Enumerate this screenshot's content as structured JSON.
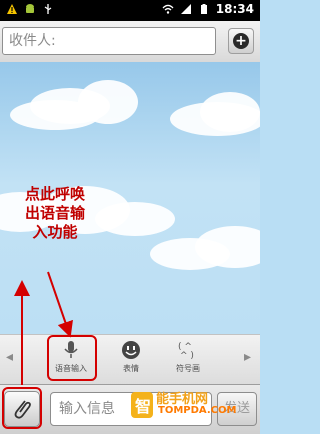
{
  "status_bar": {
    "time": "18:34",
    "icons": [
      "warning-icon",
      "android-icon",
      "usb-icon",
      "wifi-icon",
      "signal-icon",
      "battery-icon"
    ]
  },
  "recipient": {
    "placeholder": "收件人:",
    "add_icon": "plus-circle-icon"
  },
  "annotation": {
    "lines": [
      "点此呼唤",
      "出语音输",
      "入功能"
    ],
    "color": "#c00000"
  },
  "toolbar": {
    "items": [
      {
        "label": "语音输入",
        "icon": "microphone-icon"
      },
      {
        "label": "表情",
        "icon": "smiley-icon"
      },
      {
        "label": "符号画",
        "icon": "symbol-art-icon"
      }
    ]
  },
  "composer": {
    "placeholder": "输入信息",
    "send_label": "发送",
    "attach_icon": "paperclip-icon"
  },
  "watermark": {
    "brand": "能手机网",
    "url": "TOMPDA.COM"
  },
  "colors": {
    "highlight": "#d40000",
    "sky_top": "#97c8ea",
    "sky_bottom": "#bcdff4"
  }
}
